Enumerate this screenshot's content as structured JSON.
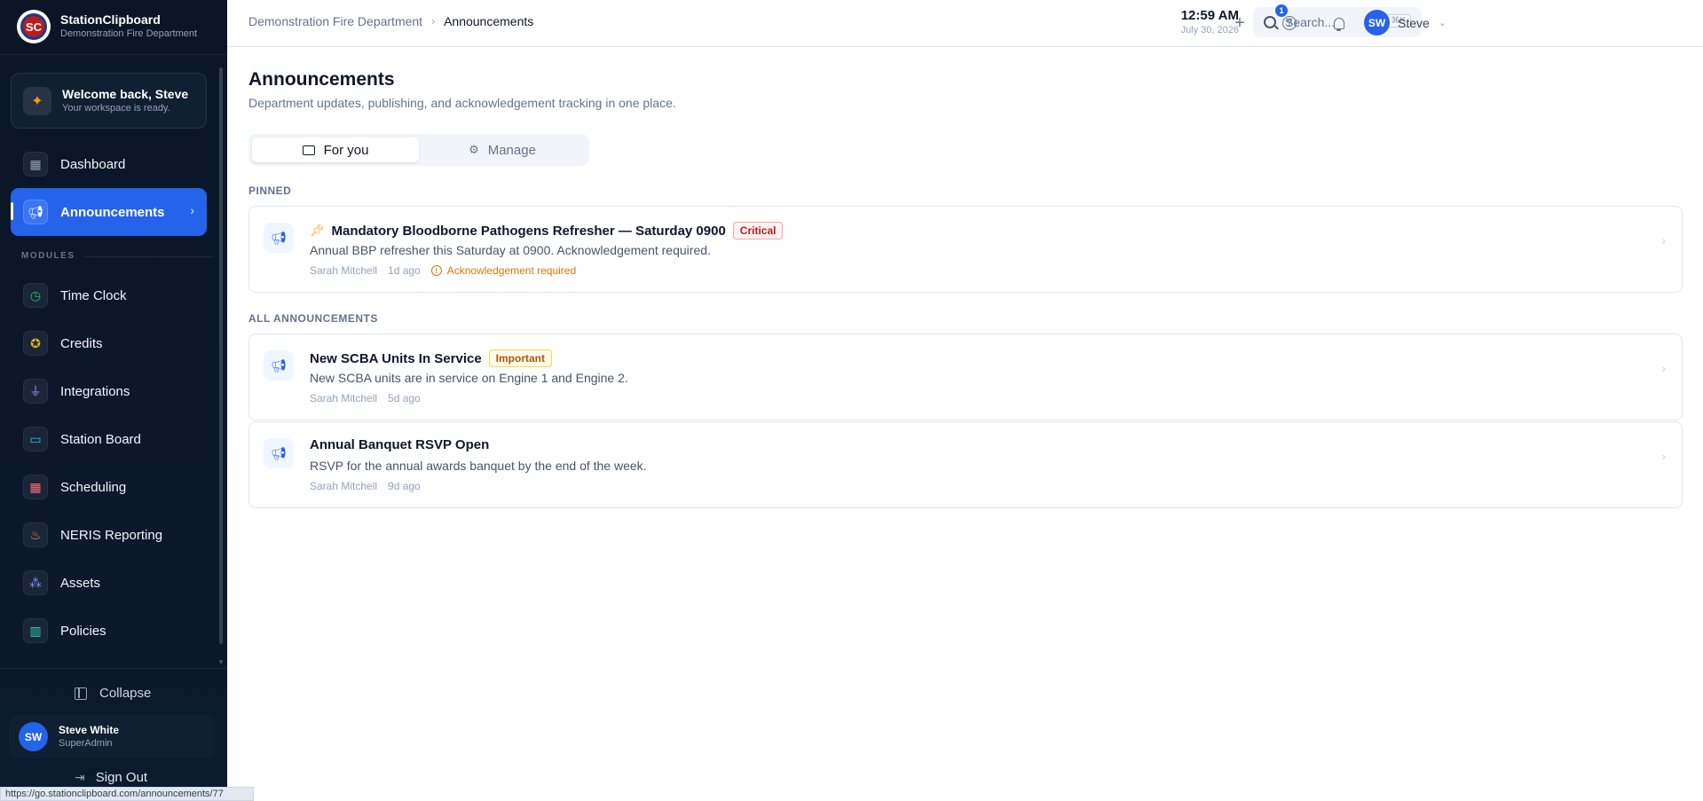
{
  "brand": {
    "name": "StationClipboard",
    "department": "Demonstration Fire Department",
    "logo_text": "SC"
  },
  "welcome": {
    "title": "Welcome back, Steve",
    "subtitle": "Your workspace is ready."
  },
  "nav": {
    "dashboard": "Dashboard",
    "announcements": "Announcements",
    "modules_label": "MODULES",
    "items": [
      {
        "label": "Time Clock",
        "icon": "clock-icon",
        "glyph": "◷",
        "color": "#22c55e"
      },
      {
        "label": "Credits",
        "icon": "award-icon",
        "glyph": "✪",
        "color": "#eab308"
      },
      {
        "label": "Integrations",
        "icon": "plug-icon",
        "glyph": "⏚",
        "color": "#a78bfa"
      },
      {
        "label": "Station Board",
        "icon": "monitor-icon",
        "glyph": "▭",
        "color": "#38bdf8"
      },
      {
        "label": "Scheduling",
        "icon": "calendar-icon",
        "glyph": "▦",
        "color": "#f87171"
      },
      {
        "label": "NERIS Reporting",
        "icon": "flame-icon",
        "glyph": "♨",
        "color": "#fb923c"
      },
      {
        "label": "Assets",
        "icon": "boxes-icon",
        "glyph": "⁂",
        "color": "#818cf8"
      },
      {
        "label": "Policies",
        "icon": "library-icon",
        "glyph": "▥",
        "color": "#2dd4bf"
      }
    ]
  },
  "sidebar_footer": {
    "collapse": "Collapse",
    "user_name": "Steve White",
    "user_role": "SuperAdmin",
    "user_initials": "SW",
    "sign_out": "Sign Out"
  },
  "status_bar": {
    "url": "https://go.stationclipboard.com/announcements/77"
  },
  "header": {
    "breadcrumb_root": "Demonstration Fire Department",
    "breadcrumb_current": "Announcements",
    "time": "12:59 AM",
    "date": "July 30, 2026",
    "search_placeholder": "Search...",
    "search_shortcut": "⌘K",
    "notification_count": "1",
    "profile_initials": "SW",
    "profile_name": "Steve"
  },
  "page": {
    "title": "Announcements",
    "subtitle": "Department updates, publishing, and acknowledgement tracking in one place.",
    "tabs": {
      "for_you": "For you",
      "manage": "Manage"
    },
    "pinned_label": "PINNED",
    "all_label": "ALL ANNOUNCEMENTS"
  },
  "pinned": [
    {
      "title": "Mandatory Bloodborne Pathogens Refresher — Saturday 0900",
      "badge": "Critical",
      "body": "Annual BBP refresher this Saturday at 0900. Acknowledgement required.",
      "author": "Sarah Mitchell",
      "time": "1d ago",
      "ack": "Acknowledgement required"
    }
  ],
  "announcements": [
    {
      "title": "New SCBA Units In Service",
      "badge": "Important",
      "body": "New SCBA units are in service on Engine 1 and Engine 2.",
      "author": "Sarah Mitchell",
      "time": "5d ago"
    },
    {
      "title": "Annual Banquet RSVP Open",
      "body": "RSVP for the annual awards banquet by the end of the week.",
      "author": "Sarah Mitchell",
      "time": "9d ago"
    }
  ]
}
